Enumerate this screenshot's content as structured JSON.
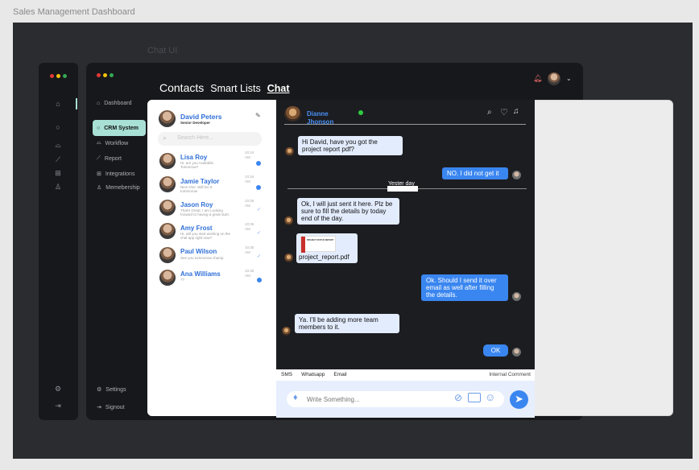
{
  "canvas": {
    "frame_title": "Sales Management Dashboard",
    "frame_label": "Chat UI"
  },
  "rail": {
    "window_dots": [
      "#e53935",
      "#f4c20d",
      "#34a853"
    ],
    "icons": [
      "home-icon",
      "chat-icon",
      "bag-icon",
      "chart-icon",
      "integrations-icon",
      "user-icon"
    ],
    "bottom_icons": [
      "settings-icon",
      "signout-icon"
    ]
  },
  "sidebar": {
    "window_dots": [
      "#e53935",
      "#f4c20d",
      "#34a853"
    ],
    "items": [
      {
        "label": "Dashboard",
        "icon": "home-icon"
      },
      {
        "label": "CRM System",
        "icon": "chat-icon",
        "active": true
      },
      {
        "label": "Workflow",
        "icon": "bag-icon"
      },
      {
        "label": "Report",
        "icon": "chart-icon"
      },
      {
        "label": "Integrations",
        "icon": "integrations-icon"
      },
      {
        "label": "Memebership",
        "icon": "user-icon"
      }
    ],
    "settings_label": "Settings",
    "signout_label": "Signout"
  },
  "header": {
    "tabs": [
      "Contacts",
      "Smart Lists",
      "Chat"
    ],
    "active_tab": "Chat",
    "accent": "#3a86f0"
  },
  "profile": {
    "name": "David Peters",
    "role": "Senior Developer"
  },
  "search": {
    "placeholder": "Search Here..."
  },
  "contacts": [
    {
      "name": "Lisa Roy",
      "message": "Hi, are you Available Tomorrow?",
      "time": "10:34 AM",
      "status": "1"
    },
    {
      "name": "Jamie Taylor",
      "message": "Nice One. Will Do It tommorow",
      "time": "10:34 AM",
      "status": "3"
    },
    {
      "name": "Jason Roy",
      "message": "That's Great. I am Looking forward to having a great start.",
      "time": "10:35 AM",
      "status": "✓"
    },
    {
      "name": "Amy Frost",
      "message": "Hi, will you start working on the chat app right now?",
      "time": "10:35 AM",
      "status": "✓"
    },
    {
      "name": "Paul Wilson",
      "message": "See you tommorow champ",
      "time": "10:35 AM",
      "status": "✓"
    },
    {
      "name": "Ana Williams",
      "message": "??",
      "time": "10:35 AM",
      "status": "2"
    }
  ],
  "chat": {
    "contact_name": "Dianne Jhonson",
    "online_color": "#2ecc40",
    "messages": [
      {
        "dir": "in",
        "text": "Hi David, have you got the project report pdf?"
      },
      {
        "dir": "out",
        "text": "NO. I did not get it"
      },
      {
        "dir": "in",
        "text": "Ok, I will just sent it here. Plz be sure to fill the details by today end of the day."
      },
      {
        "dir": "out",
        "text": "Ok. Should I send it over email as well after filling the details."
      },
      {
        "dir": "in",
        "text": "Ya. I'll be adding more team members to it."
      },
      {
        "dir": "out",
        "text": "OK"
      }
    ],
    "divider_label": "Yester day",
    "attachment": {
      "filename": "project_report.pdf",
      "preview_title": "PROJECT STATUS REPORT"
    }
  },
  "composer": {
    "channels": [
      "SMS",
      "Whatsapp",
      "Email"
    ],
    "internal_label": "Internal Comment",
    "placeholder": "Write Something..."
  }
}
